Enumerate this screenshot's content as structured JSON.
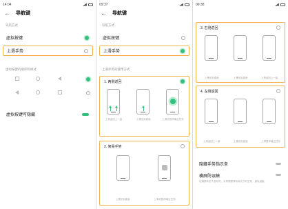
{
  "screen1": {
    "time": "14:04",
    "title": "导航键",
    "nav_mode_label": "导航方式",
    "options": [
      "虚拟按键",
      "上滑手势"
    ],
    "key_order_label": "虚拟按键的顺序和样式",
    "hide_label": "虚拟按键可隐藏"
  },
  "screen2": {
    "time": "09:37",
    "title": "导航键",
    "nav_mode_label": "导航方式",
    "options": [
      "虚拟按键",
      "上滑手势"
    ],
    "gesture_label": "上滑手势的使用方式",
    "card1": {
      "title": "1. 两侧返回",
      "captions": [
        "上滑返回上一级",
        "上滑回到桌面",
        "上滑并暂停最近任务"
      ]
    },
    "card2": {
      "title": "2. 简易手势",
      "captions": [
        "上滑回到桌面",
        "上滑并暂停最近任务"
      ]
    }
  },
  "screen3": {
    "time": "09:38",
    "card3": {
      "title": "3. 右侧返回",
      "captions": [
        "上滑回到桌面",
        "上滑回到桌面",
        "上滑返回上一级"
      ]
    },
    "card4": {
      "title": "4. 左侧返回",
      "captions": [
        "上滑返回上一级",
        "上滑回到桌面",
        "上滑暂停最近任务"
      ]
    },
    "hide_indicator_label": "隐藏手势指示条",
    "mistouch_label": "横屏防误触",
    "mistouch_sub": "在横屏状态下游戏时，手势需要滑动两次方可生效，避免误触"
  },
  "colors": {
    "accent": "#33c27d",
    "highlight": "#f0b34a"
  }
}
